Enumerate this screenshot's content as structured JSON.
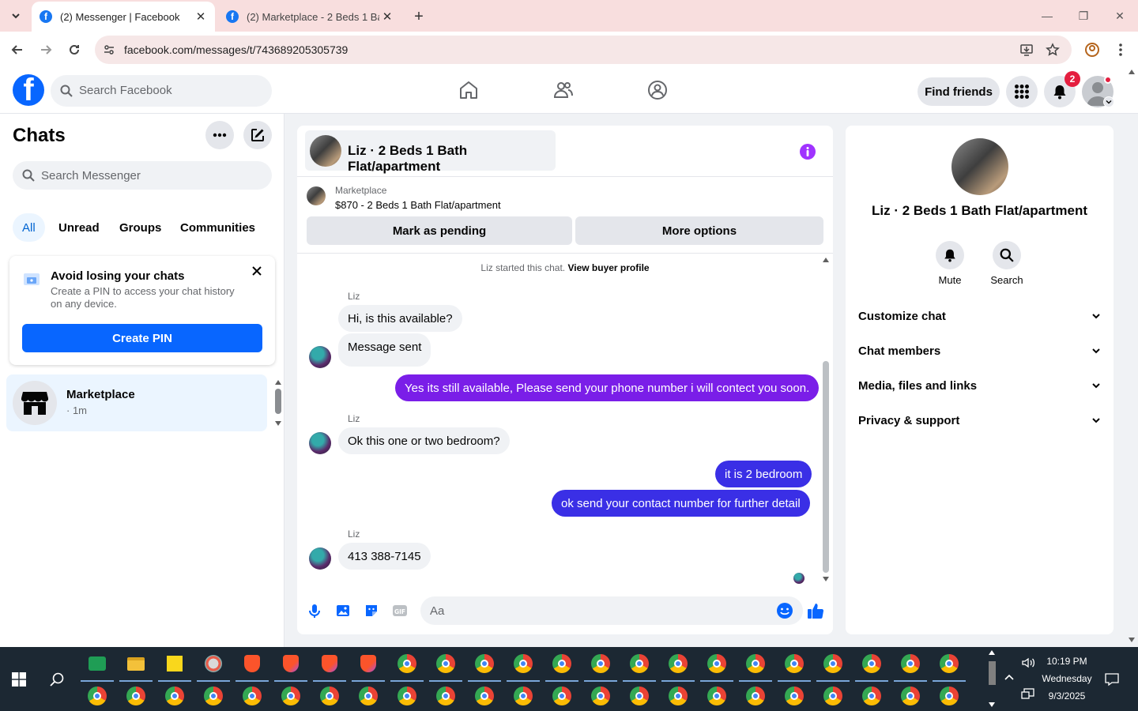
{
  "browser": {
    "tabs": [
      {
        "title": "(2) Messenger | Facebook",
        "active": true
      },
      {
        "title": "(2) Marketplace - 2 Beds 1 Bath",
        "active": false
      }
    ],
    "url": "facebook.com/messages/t/743689205305739"
  },
  "fb_header": {
    "search_placeholder": "Search Facebook",
    "find_friends_label": "Find friends",
    "notification_count": "2"
  },
  "chats": {
    "title": "Chats",
    "search_placeholder": "Search Messenger",
    "filters": [
      "All",
      "Unread",
      "Groups",
      "Communities"
    ],
    "pin_card": {
      "heading": "Avoid losing your chats",
      "description": "Create a PIN to access your chat history on any device.",
      "button": "Create PIN"
    },
    "list": [
      {
        "name": "Marketplace",
        "time": "· 1m"
      }
    ]
  },
  "conversation": {
    "title": "Liz · 2 Beds 1 Bath Flat/apartment",
    "listing": {
      "source": "Marketplace",
      "title": "$870 - 2 Beds 1 Bath Flat/apartment",
      "buttons": [
        "Mark as pending",
        "More options"
      ]
    },
    "system_text": "Liz started this chat.",
    "system_link": "View buyer profile",
    "messages": [
      {
        "sender": "Liz",
        "text": "Hi, is this available?",
        "dir": "in"
      },
      {
        "sender": "",
        "text": "Message sent",
        "dir": "in"
      },
      {
        "sender": "",
        "text": "Yes its still available, Please send your phone number i will contect you soon.",
        "dir": "out"
      },
      {
        "sender": "Liz",
        "text": "Ok this one or two bedroom?",
        "dir": "in"
      },
      {
        "sender": "",
        "text": "it is 2 bedroom",
        "dir": "out"
      },
      {
        "sender": "",
        "text": "ok send your contact number for further detail",
        "dir": "out"
      },
      {
        "sender": "Liz",
        "text": "413 388-7145",
        "dir": "in"
      }
    ],
    "composer_placeholder": "Aa"
  },
  "details": {
    "name": "Liz · 2 Beds 1 Bath Flat/apartment",
    "actions": [
      "Mute",
      "Search"
    ],
    "sections": [
      "Customize chat",
      "Chat members",
      "Media, files and links",
      "Privacy & support"
    ]
  },
  "taskbar": {
    "time": "10:19 PM",
    "day": "Wednesday",
    "date": "9/3/2025"
  },
  "colors": {
    "accent": "#0866ff",
    "outgoing_bubble_1": "#7a1ee8",
    "outgoing_bubble_2": "#3a2fe6",
    "badge": "#e41e3f"
  }
}
